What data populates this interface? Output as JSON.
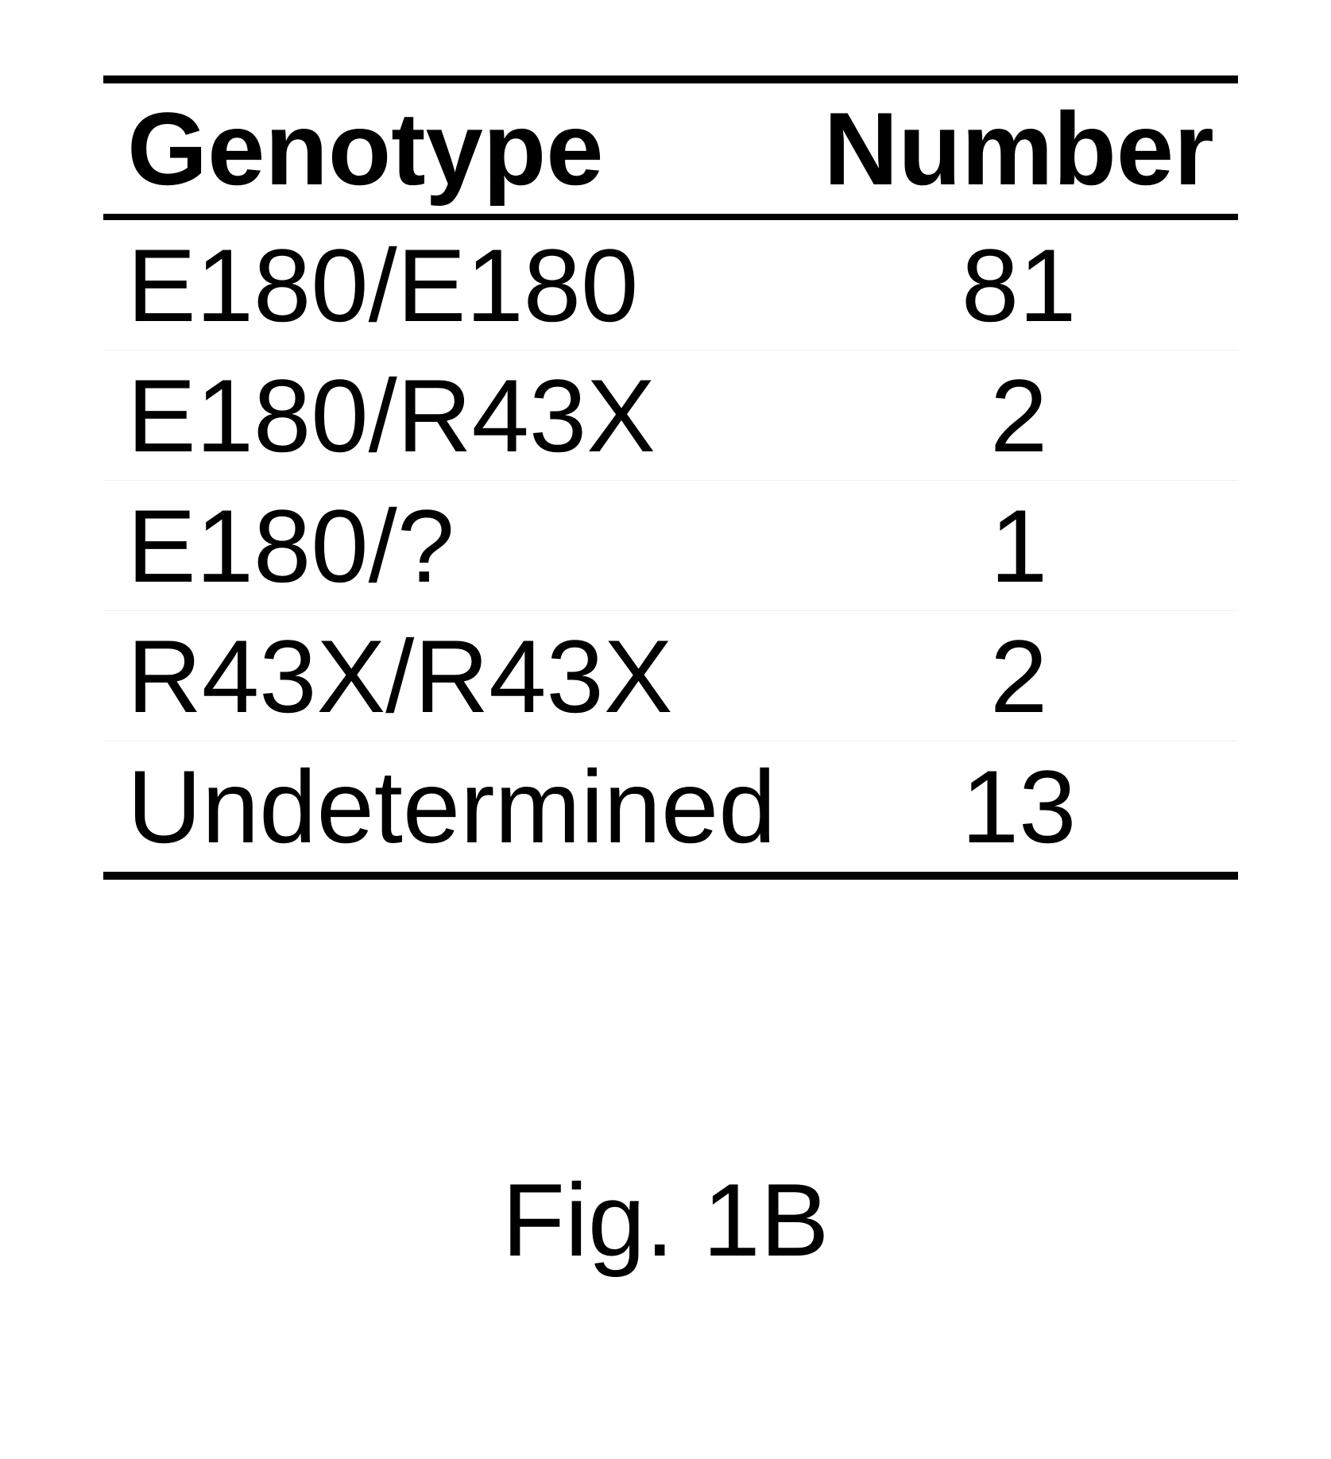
{
  "table": {
    "headers": {
      "col1": "Genotype",
      "col2": "Number"
    },
    "rows": [
      {
        "genotype": "E180/E180",
        "number": "81"
      },
      {
        "genotype": "E180/R43X",
        "number": "2"
      },
      {
        "genotype": "E180/?",
        "number": "1"
      },
      {
        "genotype": "R43X/R43X",
        "number": "2"
      },
      {
        "genotype": "Undetermined",
        "number": "13"
      }
    ]
  },
  "caption": "Fig. 1B",
  "chart_data": {
    "type": "table",
    "title": "Fig. 1B",
    "columns": [
      "Genotype",
      "Number"
    ],
    "rows": [
      [
        "E180/E180",
        81
      ],
      [
        "E180/R43X",
        2
      ],
      [
        "E180/?",
        1
      ],
      [
        "R43X/R43X",
        2
      ],
      [
        "Undetermined",
        13
      ]
    ]
  }
}
